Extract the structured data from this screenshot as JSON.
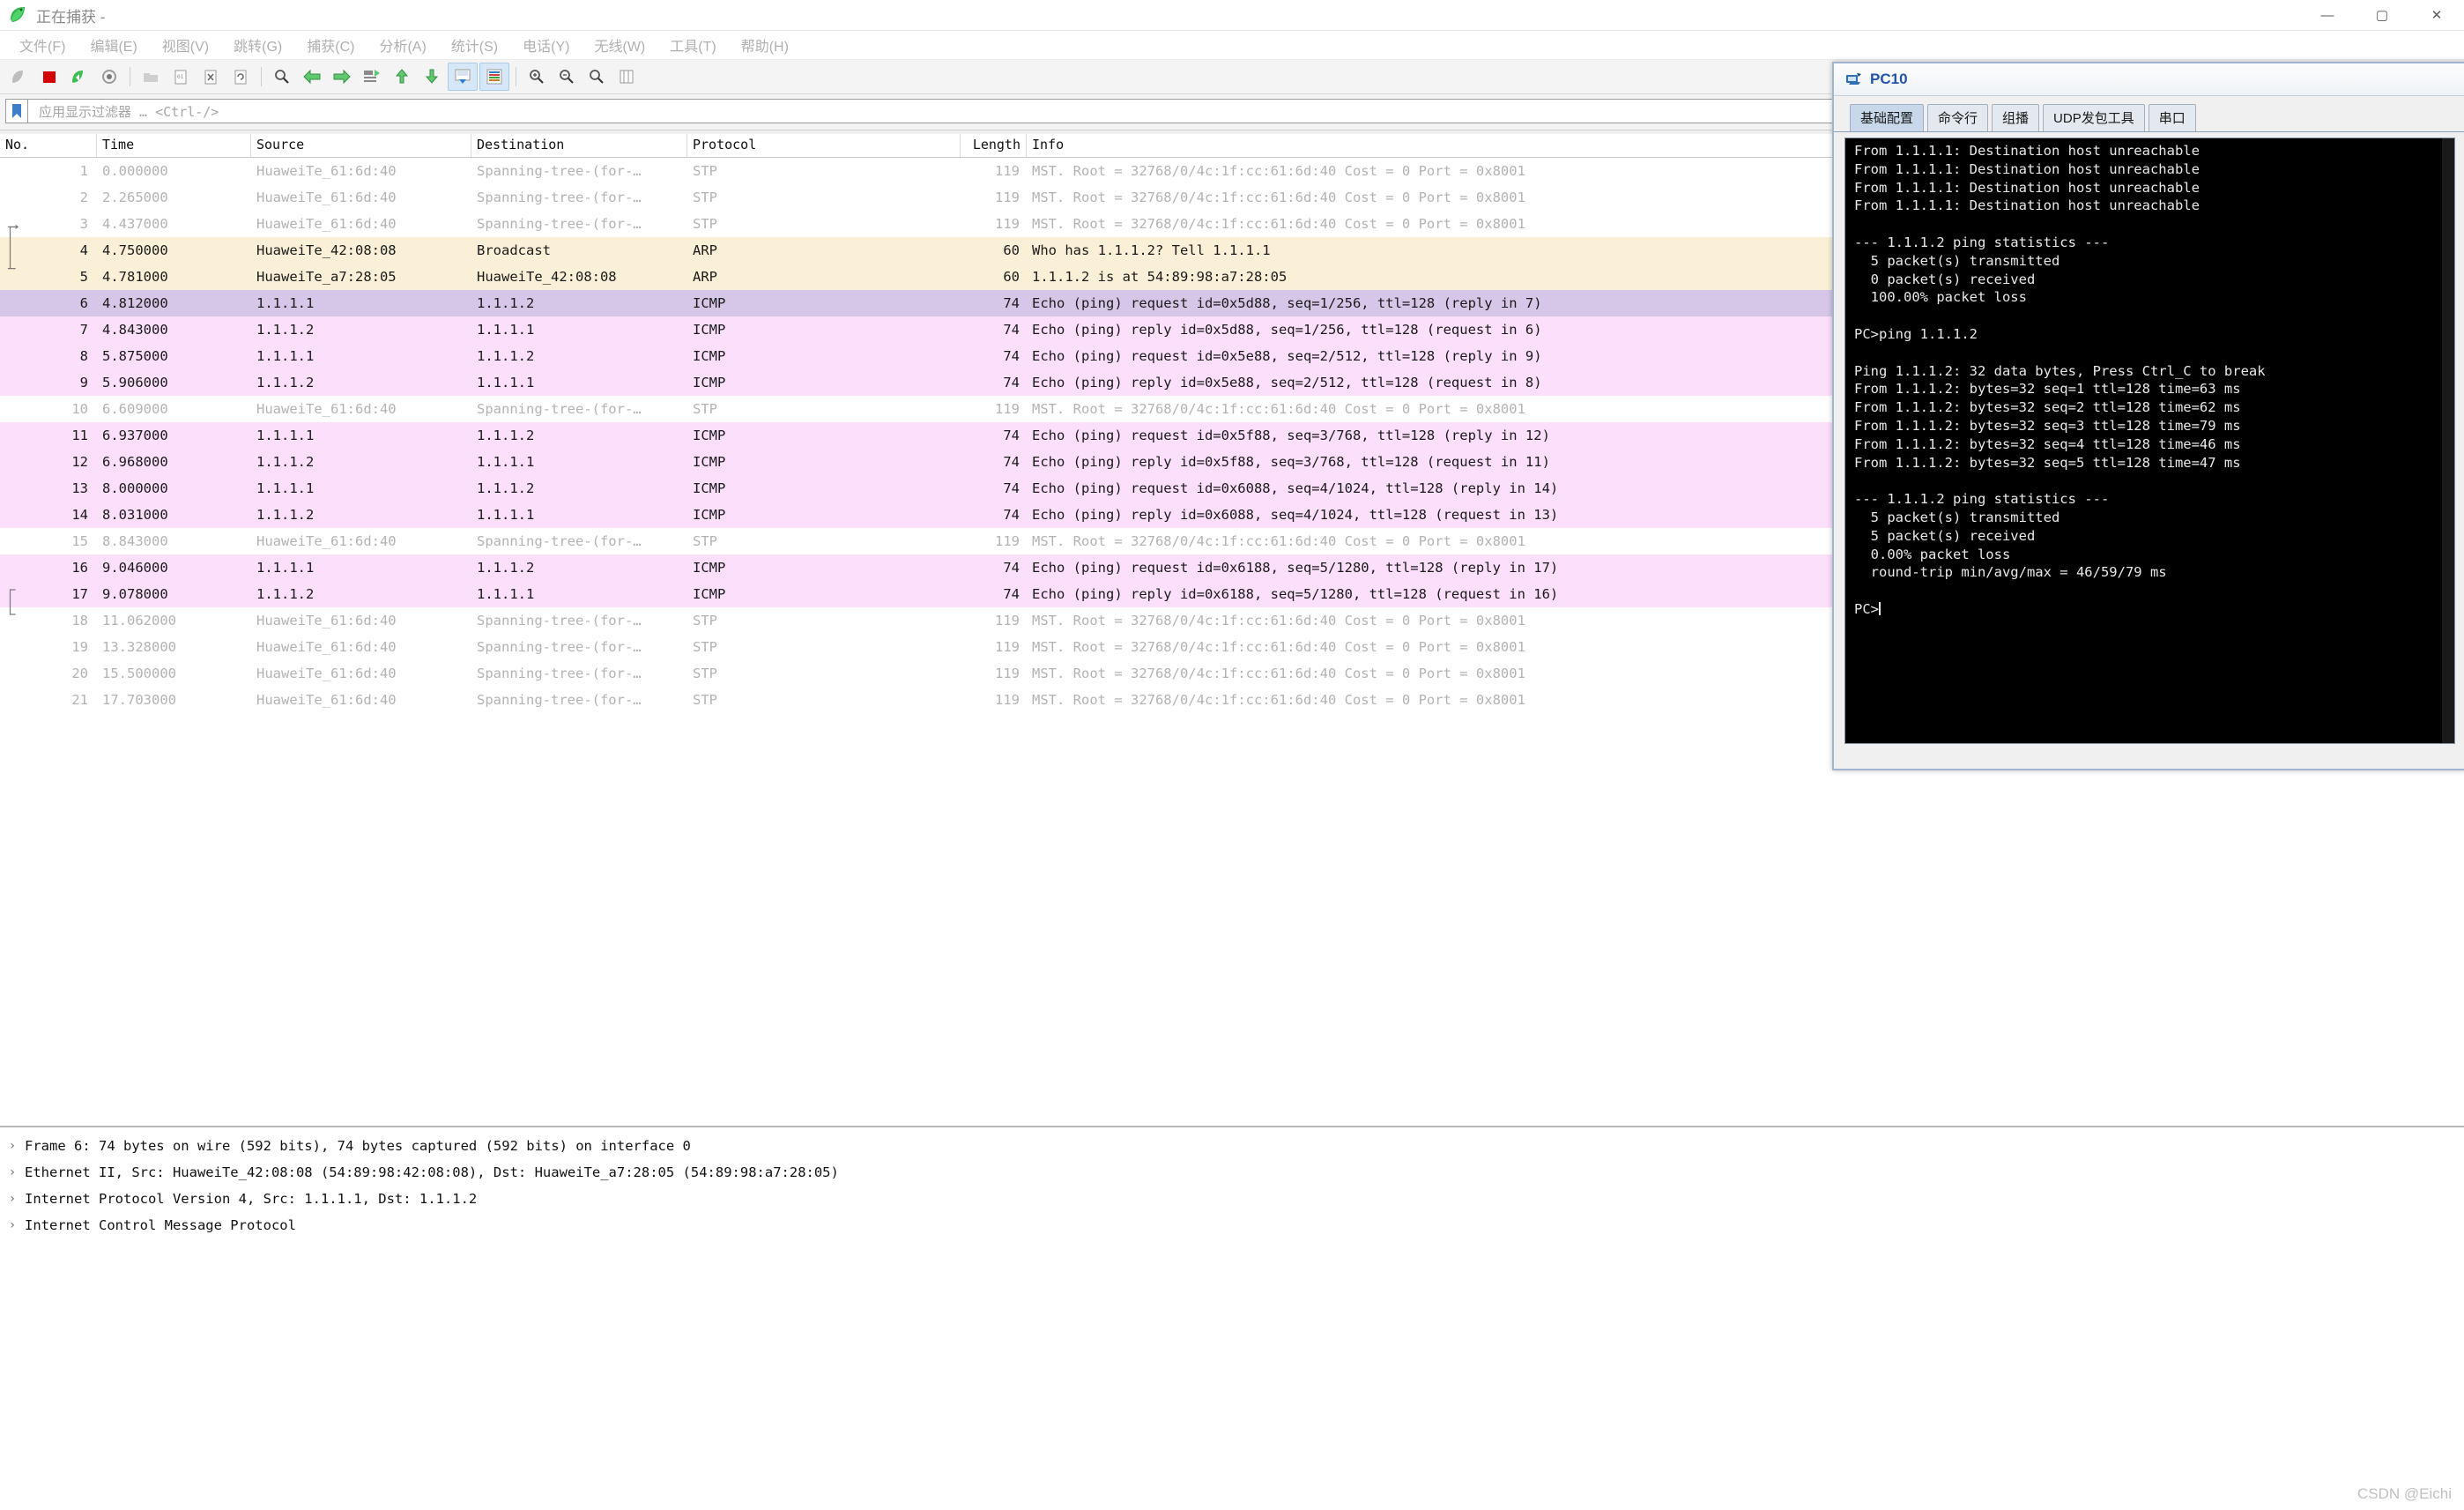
{
  "window": {
    "title": "正在捕获 -",
    "controls": {
      "minimize": "—",
      "maximize": "▢",
      "close": "✕"
    }
  },
  "menu": [
    {
      "label": "文件(F)"
    },
    {
      "label": "编辑(E)"
    },
    {
      "label": "视图(V)"
    },
    {
      "label": "跳转(G)"
    },
    {
      "label": "捕获(C)"
    },
    {
      "label": "分析(A)"
    },
    {
      "label": "统计(S)"
    },
    {
      "label": "电话(Y)"
    },
    {
      "label": "无线(W)"
    },
    {
      "label": "工具(T)"
    },
    {
      "label": "帮助(H)"
    }
  ],
  "toolbar": {
    "icons": [
      "start-capture-icon",
      "stop-capture-icon",
      "restart-capture-icon",
      "capture-options-icon",
      "open-file-icon",
      "save-file-icon",
      "close-file-icon",
      "reload-file-icon",
      "find-packet-icon",
      "go-back-icon",
      "go-forward-icon",
      "go-to-packet-icon",
      "go-first-packet-icon",
      "go-last-packet-icon",
      "autoscroll-icon",
      "colorize-icon",
      "zoom-in-icon",
      "zoom-out-icon",
      "zoom-reset-icon",
      "resize-columns-icon"
    ]
  },
  "filter": {
    "bookmark_icon": "bookmark-icon",
    "placeholder": "应用显示过滤器 … <Ctrl-/>",
    "value": ""
  },
  "packet_list": {
    "columns": [
      "No.",
      "Time",
      "Source",
      "Destination",
      "Protocol",
      "Length",
      "Info"
    ],
    "rows": [
      {
        "no": "1",
        "time": "0.000000",
        "src": "HuaweiTe_61:6d:40",
        "dst": "Spanning-tree-(for-…",
        "proto": "STP",
        "len": "119",
        "info": "MST. Root = 32768/0/4c:1f:cc:61:6d:40  Cost = 0  Port = 0x8001",
        "style": "stp"
      },
      {
        "no": "2",
        "time": "2.265000",
        "src": "HuaweiTe_61:6d:40",
        "dst": "Spanning-tree-(for-…",
        "proto": "STP",
        "len": "119",
        "info": "MST. Root = 32768/0/4c:1f:cc:61:6d:40  Cost = 0  Port = 0x8001",
        "style": "stp"
      },
      {
        "no": "3",
        "time": "4.437000",
        "src": "HuaweiTe_61:6d:40",
        "dst": "Spanning-tree-(for-…",
        "proto": "STP",
        "len": "119",
        "info": "MST. Root = 32768/0/4c:1f:cc:61:6d:40  Cost = 0  Port = 0x8001",
        "style": "stp"
      },
      {
        "no": "4",
        "time": "4.750000",
        "src": "HuaweiTe_42:08:08",
        "dst": "Broadcast",
        "proto": "ARP",
        "len": "60",
        "info": "Who has 1.1.1.2? Tell 1.1.1.1",
        "style": "arp"
      },
      {
        "no": "5",
        "time": "4.781000",
        "src": "HuaweiTe_a7:28:05",
        "dst": "HuaweiTe_42:08:08",
        "proto": "ARP",
        "len": "60",
        "info": "1.1.1.2 is at 54:89:98:a7:28:05",
        "style": "arp"
      },
      {
        "no": "6",
        "time": "4.812000",
        "src": "1.1.1.1",
        "dst": "1.1.1.2",
        "proto": "ICMP",
        "len": "74",
        "info": "Echo (ping) request  id=0x5d88, seq=1/256, ttl=128 (reply in 7)",
        "style": "icmp-sel"
      },
      {
        "no": "7",
        "time": "4.843000",
        "src": "1.1.1.2",
        "dst": "1.1.1.1",
        "proto": "ICMP",
        "len": "74",
        "info": "Echo (ping) reply    id=0x5d88, seq=1/256, ttl=128 (request in 6)",
        "style": "icmp"
      },
      {
        "no": "8",
        "time": "5.875000",
        "src": "1.1.1.1",
        "dst": "1.1.1.2",
        "proto": "ICMP",
        "len": "74",
        "info": "Echo (ping) request  id=0x5e88, seq=2/512, ttl=128 (reply in 9)",
        "style": "icmp"
      },
      {
        "no": "9",
        "time": "5.906000",
        "src": "1.1.1.2",
        "dst": "1.1.1.1",
        "proto": "ICMP",
        "len": "74",
        "info": "Echo (ping) reply    id=0x5e88, seq=2/512, ttl=128 (request in 8)",
        "style": "icmp"
      },
      {
        "no": "10",
        "time": "6.609000",
        "src": "HuaweiTe_61:6d:40",
        "dst": "Spanning-tree-(for-…",
        "proto": "STP",
        "len": "119",
        "info": "MST. Root = 32768/0/4c:1f:cc:61:6d:40  Cost = 0  Port = 0x8001",
        "style": "stp"
      },
      {
        "no": "11",
        "time": "6.937000",
        "src": "1.1.1.1",
        "dst": "1.1.1.2",
        "proto": "ICMP",
        "len": "74",
        "info": "Echo (ping) request  id=0x5f88, seq=3/768, ttl=128 (reply in 12)",
        "style": "icmp"
      },
      {
        "no": "12",
        "time": "6.968000",
        "src": "1.1.1.2",
        "dst": "1.1.1.1",
        "proto": "ICMP",
        "len": "74",
        "info": "Echo (ping) reply    id=0x5f88, seq=3/768, ttl=128 (request in 11)",
        "style": "icmp"
      },
      {
        "no": "13",
        "time": "8.000000",
        "src": "1.1.1.1",
        "dst": "1.1.1.2",
        "proto": "ICMP",
        "len": "74",
        "info": "Echo (ping) request  id=0x6088, seq=4/1024, ttl=128 (reply in 14)",
        "style": "icmp"
      },
      {
        "no": "14",
        "time": "8.031000",
        "src": "1.1.1.2",
        "dst": "1.1.1.1",
        "proto": "ICMP",
        "len": "74",
        "info": "Echo (ping) reply    id=0x6088, seq=4/1024, ttl=128 (request in 13)",
        "style": "icmp"
      },
      {
        "no": "15",
        "time": "8.843000",
        "src": "HuaweiTe_61:6d:40",
        "dst": "Spanning-tree-(for-…",
        "proto": "STP",
        "len": "119",
        "info": "MST. Root = 32768/0/4c:1f:cc:61:6d:40  Cost = 0  Port = 0x8001",
        "style": "stp"
      },
      {
        "no": "16",
        "time": "9.046000",
        "src": "1.1.1.1",
        "dst": "1.1.1.2",
        "proto": "ICMP",
        "len": "74",
        "info": "Echo (ping) request  id=0x6188, seq=5/1280, ttl=128 (reply in 17)",
        "style": "icmp"
      },
      {
        "no": "17",
        "time": "9.078000",
        "src": "1.1.1.2",
        "dst": "1.1.1.1",
        "proto": "ICMP",
        "len": "74",
        "info": "Echo (ping) reply    id=0x6188, seq=5/1280, ttl=128 (request in 16)",
        "style": "icmp"
      },
      {
        "no": "18",
        "time": "11.062000",
        "src": "HuaweiTe_61:6d:40",
        "dst": "Spanning-tree-(for-…",
        "proto": "STP",
        "len": "119",
        "info": "MST. Root = 32768/0/4c:1f:cc:61:6d:40  Cost = 0  Port = 0x8001",
        "style": "stp"
      },
      {
        "no": "19",
        "time": "13.328000",
        "src": "HuaweiTe_61:6d:40",
        "dst": "Spanning-tree-(for-…",
        "proto": "STP",
        "len": "119",
        "info": "MST. Root = 32768/0/4c:1f:cc:61:6d:40  Cost = 0  Port = 0x8001",
        "style": "stp"
      },
      {
        "no": "20",
        "time": "15.500000",
        "src": "HuaweiTe_61:6d:40",
        "dst": "Spanning-tree-(for-…",
        "proto": "STP",
        "len": "119",
        "info": "MST. Root = 32768/0/4c:1f:cc:61:6d:40  Cost = 0  Port = 0x8001",
        "style": "stp"
      },
      {
        "no": "21",
        "time": "17.703000",
        "src": "HuaweiTe_61:6d:40",
        "dst": "Spanning-tree-(for-…",
        "proto": "STP",
        "len": "119",
        "info": "MST. Root = 32768/0/4c:1f:cc:61:6d:40  Cost = 0  Port = 0x8001",
        "style": "stp"
      }
    ]
  },
  "packet_details": {
    "lines": [
      "Frame 6: 74 bytes on wire (592 bits), 74 bytes captured (592 bits) on interface 0",
      "Ethernet II, Src: HuaweiTe_42:08:08 (54:89:98:42:08:08), Dst: HuaweiTe_a7:28:05 (54:89:98:a7:28:05)",
      "Internet Protocol Version 4, Src: 1.1.1.1, Dst: 1.1.1.2",
      "Internet Control Message Protocol"
    ],
    "caret": "›"
  },
  "pc10": {
    "title": "PC10",
    "title_icon": "pc-terminal-icon",
    "tabs": [
      {
        "label": "基础配置",
        "active": true
      },
      {
        "label": "命令行",
        "active": false
      },
      {
        "label": "组播",
        "active": false
      },
      {
        "label": "UDP发包工具",
        "active": false
      },
      {
        "label": "串口",
        "active": false
      }
    ],
    "terminal": "From 1.1.1.1: Destination host unreachable\nFrom 1.1.1.1: Destination host unreachable\nFrom 1.1.1.1: Destination host unreachable\nFrom 1.1.1.1: Destination host unreachable\n\n--- 1.1.1.2 ping statistics ---\n  5 packet(s) transmitted\n  0 packet(s) received\n  100.00% packet loss\n\nPC>ping 1.1.1.2\n\nPing 1.1.1.2: 32 data bytes, Press Ctrl_C to break\nFrom 1.1.1.2: bytes=32 seq=1 ttl=128 time=63 ms\nFrom 1.1.1.2: bytes=32 seq=2 ttl=128 time=62 ms\nFrom 1.1.1.2: bytes=32 seq=3 ttl=128 time=79 ms\nFrom 1.1.1.2: bytes=32 seq=4 ttl=128 time=46 ms\nFrom 1.1.1.2: bytes=32 seq=5 ttl=128 time=47 ms\n\n--- 1.1.1.2 ping statistics ---\n  5 packet(s) transmitted\n  5 packet(s) received\n  0.00% packet loss\n  round-trip min/avg/max = 46/59/79 ms\n\nPC>"
  },
  "watermark": "CSDN @Eichi",
  "colors": {
    "arp_row": "#faf0d7",
    "icmp_row": "#fbdffb",
    "icmp_selected_row": "#d6c7e8",
    "stp_text": "#b3b3b3",
    "accent": "#2255aa"
  }
}
